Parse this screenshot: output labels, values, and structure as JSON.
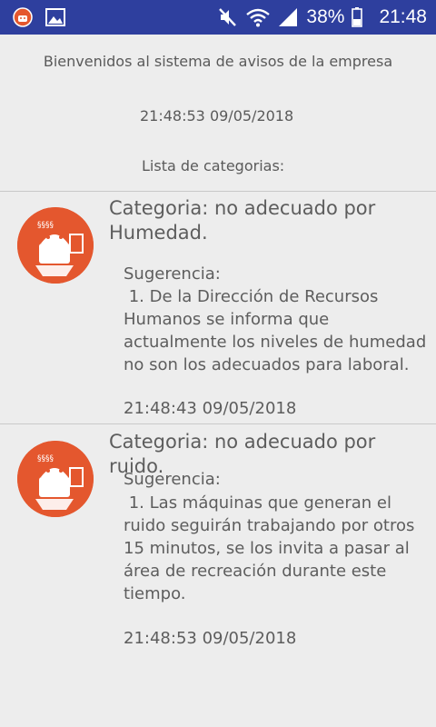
{
  "status_bar": {
    "left_icons": [
      "app-notification-icon",
      "image-icon"
    ],
    "right_icons": [
      "mute-icon",
      "wifi-icon",
      "signal-icon"
    ],
    "battery": "38%",
    "battery_icon": "battery-icon",
    "time": "21:48"
  },
  "header": {
    "welcome": "Bienvenidos al sistema de avisos de la empresa",
    "timestamp": "21:48:53 09/05/2018",
    "list_title": "Lista de categorias:"
  },
  "notices": [
    {
      "icon": "android-app-icon",
      "category": "Categoria: no adecuado por Humedad.",
      "label": "Sugerencia:",
      "body": " 1. De la Dirección de Recursos Humanos se informa que actualmente los niveles de humedad no son los adecuados para laboral.",
      "time": "21:48:43 09/05/2018"
    },
    {
      "icon": "android-app-icon",
      "category": "Categoria: no adecuado por ruido.",
      "label": "Sugerencia:",
      "body": " 1. Las máquinas que generan el ruido seguirán trabajando por otros 15 minutos, se los invita a pasar al área de recreación durante este tiempo.",
      "time": "21:48:53 09/05/2018"
    }
  ],
  "colors": {
    "status_bar": "#2e3f9e",
    "icon_orange": "#e4572e",
    "background": "#ededed",
    "text": "#5a5a5a"
  }
}
